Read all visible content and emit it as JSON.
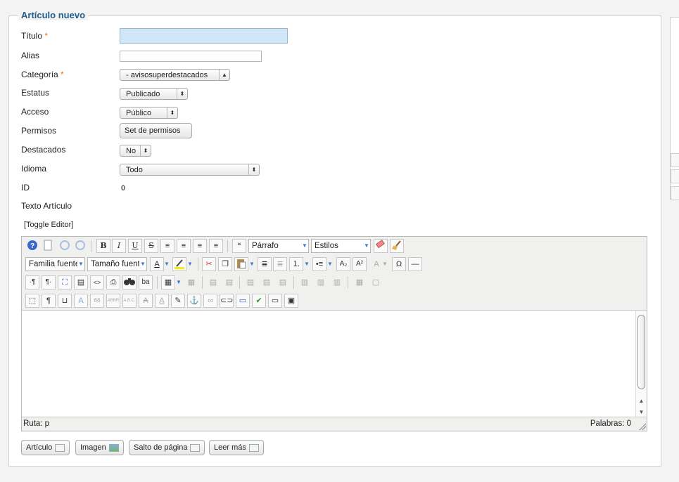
{
  "form": {
    "legend": "Artículo nuevo",
    "fields": {
      "titulo_label": "Título",
      "alias_label": "Alias",
      "categoria_label": "Categoría",
      "estatus_label": "Estatus",
      "acceso_label": "Acceso",
      "permisos_label": "Permisos",
      "destacados_label": "Destacados",
      "idioma_label": "Idioma",
      "id_label": "ID",
      "texto_label": "Texto Artículo",
      "required_mark": "*"
    },
    "values": {
      "titulo": "",
      "alias": "",
      "categoria": "- avisosuperdestacados",
      "estatus": "Publicado",
      "acceso": "Público",
      "permisos_button": "Set de permisos",
      "destacados": "No",
      "idioma": "Todo",
      "id": "0"
    }
  },
  "editor": {
    "toggle": "[Toggle Editor]",
    "format_select": "Párrafo",
    "styles_select": "Estilos",
    "font_family_select": "Familia fuente",
    "font_size_select": "Tamaño fuente",
    "status_path": "Ruta:  p",
    "word_count": "Palabras: 0",
    "icons": {
      "bold": "B",
      "italic": "I",
      "underline": "U",
      "strike": "S",
      "blockquote": "“",
      "subscript": "A₂",
      "superscript": "A²",
      "omega": "Ω",
      "pilcrow": "¶",
      "ltr": "·¶",
      "rtl": "¶·"
    }
  },
  "bottom_buttons": {
    "articulo": "Artículo",
    "imagen": "Imagen",
    "salto": "Salto de página",
    "leer_mas": "Leer más"
  },
  "colors": {
    "legend": "#1f5c8a",
    "required": "#e07b00",
    "active_input": "#cfe6f7"
  }
}
